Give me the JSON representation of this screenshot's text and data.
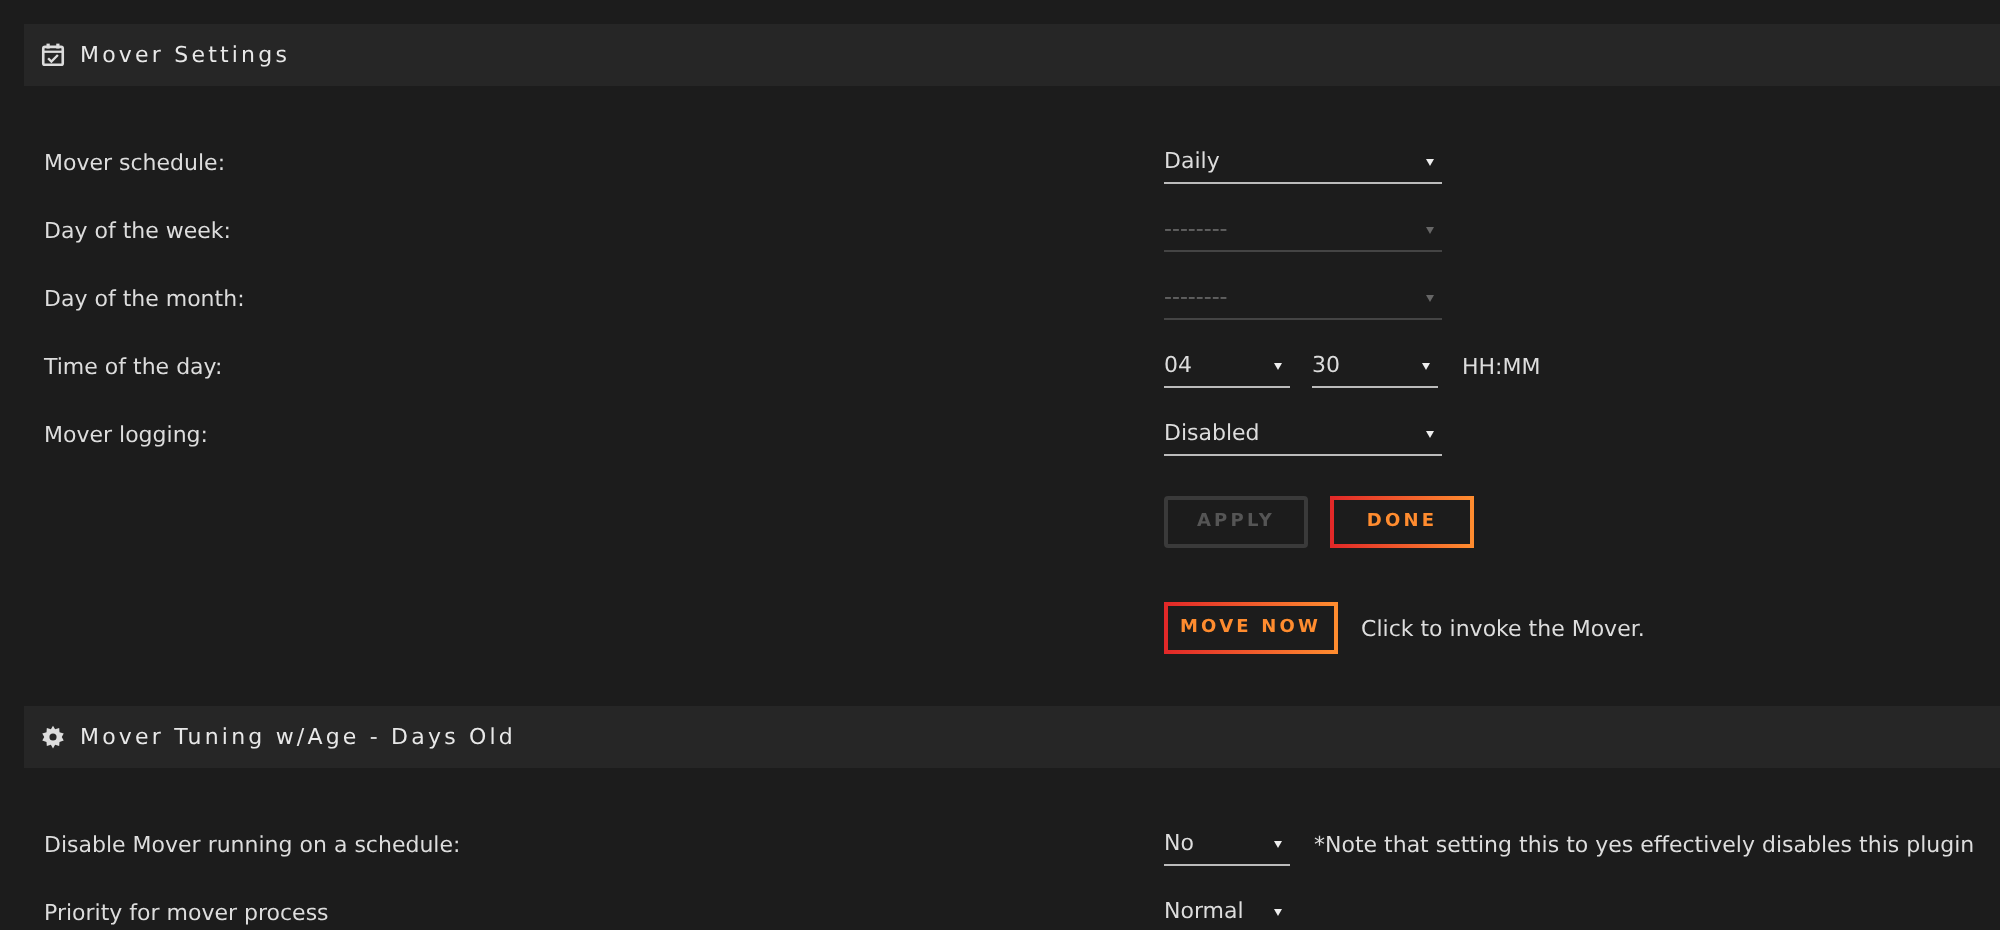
{
  "sections": [
    {
      "title": "Mover Settings",
      "rows": [
        {
          "kind": "field",
          "label": "Mover schedule:",
          "controls": [
            {
              "value": "Daily",
              "disabled": false
            }
          ]
        },
        {
          "kind": "field",
          "label": "Day of the week:",
          "controls": [
            {
              "value": "--------",
              "disabled": true
            }
          ]
        },
        {
          "kind": "field",
          "label": "Day of the month:",
          "controls": [
            {
              "value": "--------",
              "disabled": true
            }
          ]
        },
        {
          "kind": "field",
          "label": "Time of the day:",
          "controls": [
            {
              "value": "04",
              "disabled": false
            },
            {
              "value": "30",
              "disabled": false
            }
          ],
          "note": "HH:MM"
        },
        {
          "kind": "field",
          "label": "Mover logging:",
          "controls": [
            {
              "value": "Disabled",
              "disabled": false
            }
          ]
        },
        {
          "kind": "actions",
          "buttons": [
            {
              "label": "APPLY",
              "disabled": true
            },
            {
              "label": "DONE",
              "disabled": false
            }
          ]
        },
        {
          "kind": "actions",
          "buttons": [
            {
              "label": "MOVE NOW",
              "disabled": false
            }
          ],
          "note": "Click to invoke the Mover."
        }
      ]
    },
    {
      "title": "Mover Tuning w/Age - Days Old",
      "rows": [
        {
          "kind": "field",
          "label": "Disable Mover running on a schedule:",
          "controls": [
            {
              "value": "No",
              "disabled": false
            }
          ],
          "note": "*Note that setting this to yes effectively disables this plugin"
        },
        {
          "kind": "field",
          "label": "Priority for mover process",
          "controls": [
            {
              "value": "Normal",
              "disabled": false
            }
          ]
        }
      ]
    }
  ]
}
